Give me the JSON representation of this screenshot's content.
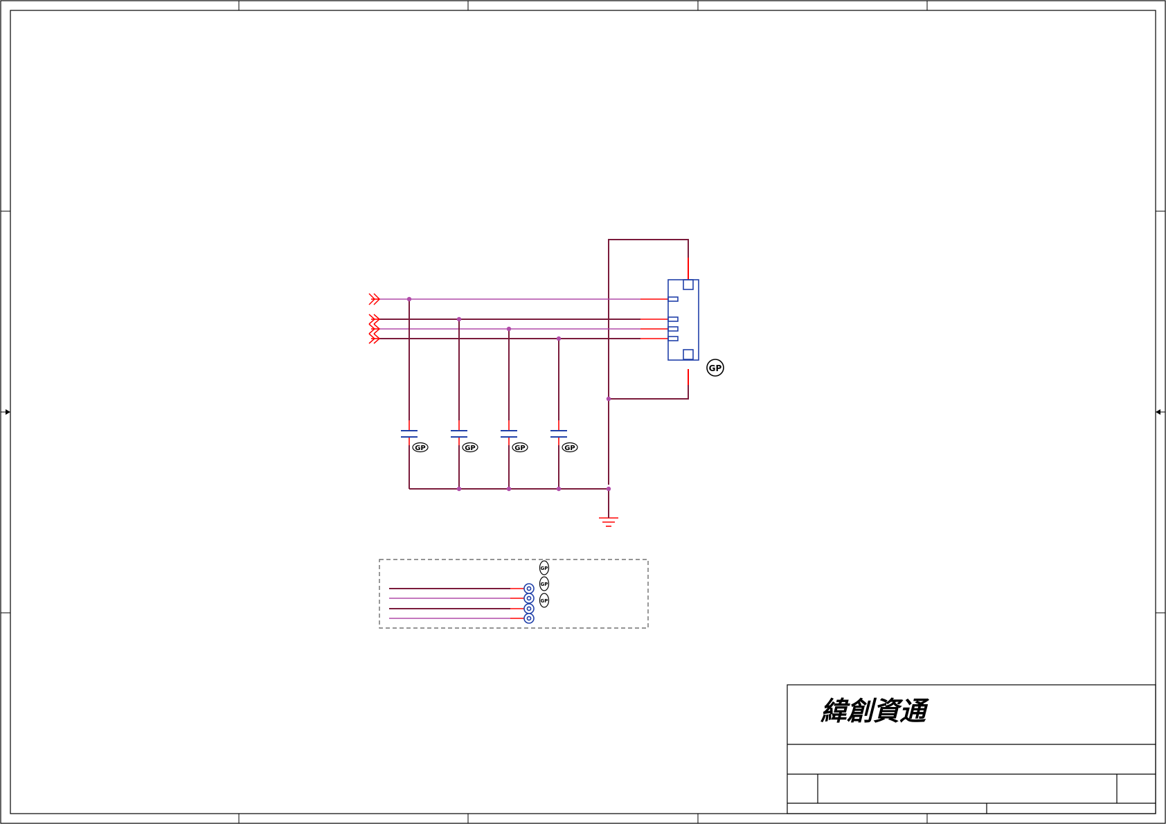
{
  "title_block": {
    "company_name": "緯創資通"
  },
  "component_marks": {
    "connector_mark": "GP",
    "capacitor_marks": [
      "GP",
      "GP",
      "GP",
      "GP"
    ],
    "mounting_hole_marks": [
      "GP",
      "GP",
      "GP"
    ]
  },
  "colors": {
    "border": "#000000",
    "wire": "#7a1a3a",
    "pin_stub": "#ff0000",
    "junction": "#b04aa8",
    "component": "#1f3fa8",
    "dashed_box": "#555555"
  },
  "icons": {
    "off_page_connector": "double-chevron-arrow",
    "ground": "ground-symbol",
    "capacitor": "capacitor-symbol",
    "connector": "connector-body",
    "mounting_hole": "concentric-circle-pad"
  }
}
